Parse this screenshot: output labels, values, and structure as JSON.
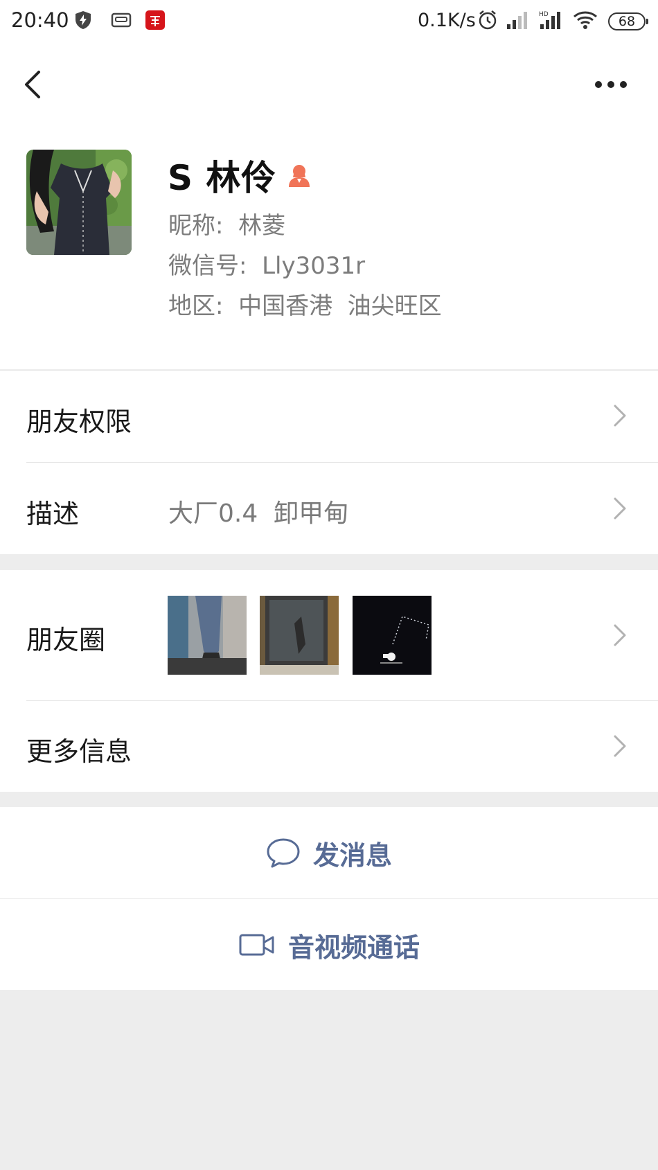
{
  "status_bar": {
    "time": "20:40",
    "net_speed": "0.1K/s",
    "battery": "68",
    "icons": [
      "shield-bolt-icon",
      "tape-icon",
      "xuexi-app-icon",
      "alarm-icon",
      "signal-icon",
      "hd-signal-icon",
      "wifi-icon",
      "battery-icon"
    ]
  },
  "nav": {
    "back_icon": "chevron-left-icon",
    "more_icon": "more-dots-icon"
  },
  "profile": {
    "name": "S 林伶",
    "gender_icon": "female-person-icon",
    "nickname": "昵称:  林菱",
    "wechat_id": "微信号:  Lly3031r",
    "region": "地区:  中国香港  油尖旺区"
  },
  "rows": {
    "friend_permissions": "朋友权限",
    "description_label": "描述",
    "description_value": "大厂0.4  卸甲甸",
    "moments_label": "朋友圈",
    "more_info": "更多信息"
  },
  "actions": {
    "send_message": "发消息",
    "video_call": "音视频通话"
  },
  "colors": {
    "link_blue": "#576b95",
    "gender_orange": "#f07458",
    "page_bg": "#ededed"
  }
}
